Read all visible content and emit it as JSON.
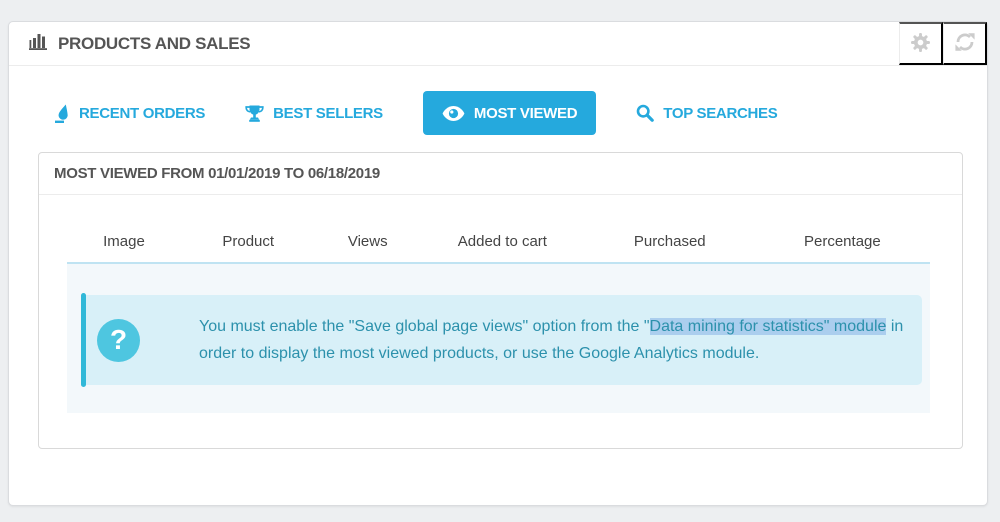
{
  "panel": {
    "title": "PRODUCTS AND SALES",
    "title_icon": "bar-chart-icon",
    "actions": [
      {
        "icon": "gear-icon"
      },
      {
        "icon": "refresh-icon"
      }
    ]
  },
  "tabs": [
    {
      "label": "RECENT ORDERS",
      "icon": "ink-drop-icon",
      "active": false
    },
    {
      "label": "BEST SELLERS",
      "icon": "trophy-icon",
      "active": false
    },
    {
      "label": "MOST VIEWED",
      "icon": "eye-icon",
      "active": true
    },
    {
      "label": "TOP SEARCHES",
      "icon": "search-icon",
      "active": false
    }
  ],
  "most_viewed": {
    "heading": "MOST VIEWED FROM 01/01/2019 TO 06/18/2019",
    "columns": [
      "Image",
      "Product",
      "Views",
      "Added to cart",
      "Purchased",
      "Percentage"
    ],
    "notice": {
      "icon_glyph": "?",
      "parts": [
        "You must enable the \"Save global page views\" option from the \"",
        "Data mining for statistics\" module",
        " in order to display the most viewed products, or use the Google Analytics module."
      ],
      "highlighted_part_index": 1
    }
  },
  "colors": {
    "accent_blue": "#25a9dd",
    "panel_title_text": "#555555",
    "alert_background": "#d8f0f8",
    "alert_accent_bar": "#30b8d8",
    "alert_icon_circle": "#4ec6e0",
    "alert_text": "#2c91ac",
    "selection_highlight": "#abceee",
    "table_header_separator": "#bfe3f2",
    "table_body_background": "#f3f8fb",
    "header_action_icon": "#cccccc",
    "page_background": "#edeff1"
  }
}
